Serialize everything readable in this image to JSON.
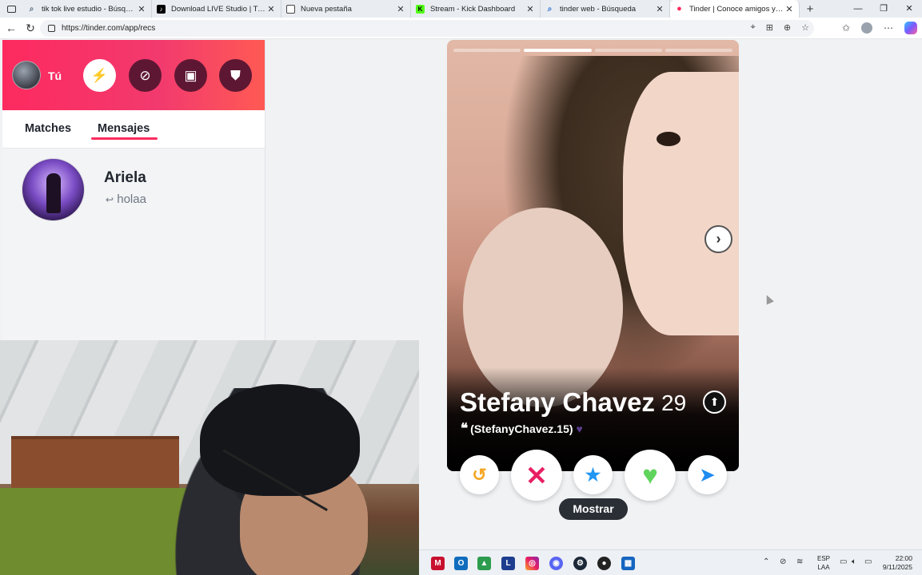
{
  "browser": {
    "tabs": [
      {
        "title": "tik tok live estudio - Búsqueda",
        "icon": "search-icon"
      },
      {
        "title": "Download LIVE Studio | TikTok",
        "icon": "tiktok-icon"
      },
      {
        "title": "Nueva pestaña",
        "icon": "newtab-icon"
      },
      {
        "title": "Stream - Kick Dashboard",
        "icon": "kick-icon"
      },
      {
        "title": "tinder web - Búsqueda",
        "icon": "search-icon"
      },
      {
        "title": "Tinder | Conoce amigos y gente n",
        "icon": "tinder-flame-icon"
      }
    ],
    "new_tab": "+",
    "url": "https://tinder.com/app/recs"
  },
  "sidebar": {
    "me_label": "Tú",
    "tabs": {
      "matches": "Matches",
      "messages": "Mensajes"
    },
    "conversation": {
      "name": "Ariela",
      "preview": "holaa",
      "reply_arrow": "↩"
    }
  },
  "card": {
    "name": "Stefany Chavez",
    "age": "29",
    "bio": "(StefanyChavez.15)",
    "photo_count": 4,
    "active_photo": 2
  },
  "actions": {
    "tooltip": "Mostrar"
  },
  "taskbar": {
    "lang_line1": "ESP",
    "lang_line2": "LAA",
    "time": "22:00",
    "date": "9/11/2025"
  },
  "colors": {
    "tinder_pink": "#fd2a5f",
    "rewind": "#f5a623",
    "nope": "#e81e63",
    "superlike": "#2196f3",
    "like": "#5fd35b",
    "boost": "#1e8cf0"
  }
}
